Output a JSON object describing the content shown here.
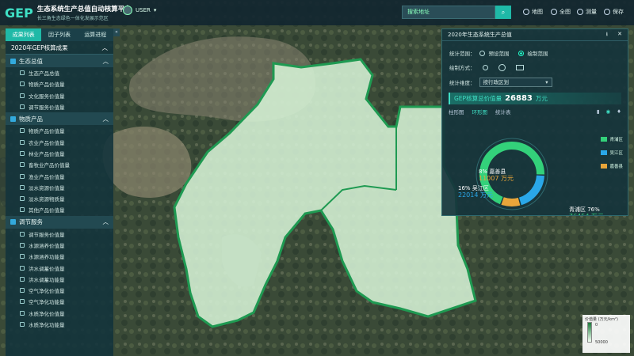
{
  "header": {
    "logo": "GEP",
    "title": "生态系统生产总值自动核算平台",
    "subtitle": "长三角生态绿色一体化发展示范区",
    "user": "USER",
    "search_placeholder": "搜索地址",
    "tools": [
      "地图",
      "全图",
      "测量",
      "保存"
    ]
  },
  "sidebar": {
    "tabs": [
      "成果列表",
      "因子列表",
      "运算进程"
    ],
    "active_tab": 0,
    "section_title": "2020年GEP核算成果",
    "groups": [
      {
        "label": "生态总值",
        "items": [
          "生态产品总值",
          "物质产品价值量",
          "文化服务价值量",
          "调节服务价值量"
        ]
      },
      {
        "label": "物质产品",
        "items": [
          "物质产品价值量",
          "农业产品价值量",
          "林业产品价值量",
          "畜牧业产品价值量",
          "渔业产品价值量",
          "淡水资源价值量",
          "淡水资源物质量",
          "其他产品价值量"
        ]
      },
      {
        "label": "调节服务",
        "items": [
          "调节服务价值量",
          "水源涵养价值量",
          "水源涵养功能量",
          "洪水调蓄价值量",
          "洪水调蓄功能量",
          "空气净化价值量",
          "空气净化功能量",
          "水质净化价值量",
          "水质净化功能量"
        ]
      }
    ]
  },
  "panel": {
    "title": "2020年生态系统生产总值",
    "range_label": "统计范围：",
    "range_options": [
      "预设范围",
      "绘制范围"
    ],
    "draw_label": "绘制方式：",
    "dimension_label": "统计维度：",
    "dimension_value": "按行政区划",
    "total_label": "GEP核算总价值量",
    "total_value": "26883",
    "total_unit": "万元",
    "chart_tabs": [
      "柱形图",
      "环形图",
      "统计表"
    ],
    "active_chart_tab": 1
  },
  "chart_data": {
    "type": "pie",
    "title": "",
    "categories": [
      "青浦区",
      "吴江区",
      "嘉善县"
    ],
    "values": [
      76454,
      22014,
      11007
    ],
    "percents": [
      "76%",
      "16%",
      "8%"
    ],
    "unit": "万元",
    "colors": [
      "#33d17a",
      "#2aa7e8",
      "#e8a53a"
    ],
    "legend_position": "right"
  },
  "scale": {
    "title": "价值量 (万元/km²)",
    "min": "0",
    "max": "50000"
  }
}
